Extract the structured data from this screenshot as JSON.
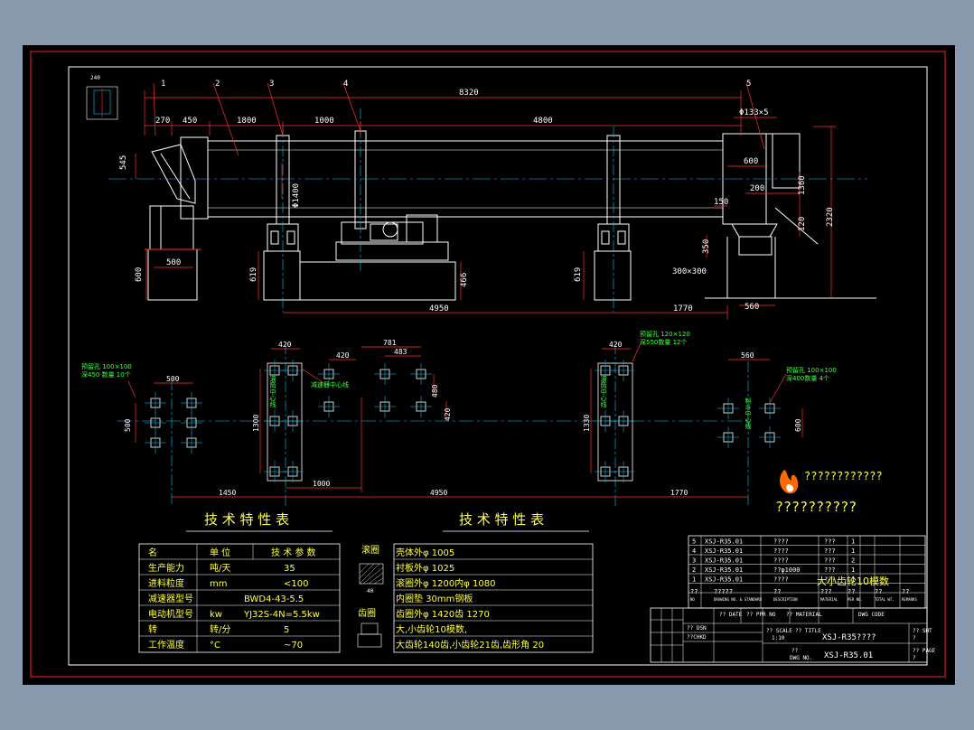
{
  "colors": {
    "background": "#000000",
    "border_red": "#ff2020",
    "geometry_white": "#ffffff",
    "dimension_red": "#ff3030",
    "centerline_cyan": "#00c8ff",
    "text_yellow": "#ffff40",
    "text_green": "#40ff40",
    "title_yellow": "#ffff00",
    "frame_white": "#ffffff",
    "page_gray": "#8a9aae"
  },
  "labels": {
    "item1": "1",
    "item2": "2",
    "item3": "3",
    "item4": "4",
    "item5": "5",
    "detail_small": "240"
  },
  "dims_top": {
    "total": "8320",
    "d270": "270",
    "d450": "450",
    "d1800": "1800",
    "d1000": "1000",
    "d4800": "4800",
    "d545": "545",
    "dia1400": "Φ1400",
    "d600l": "600",
    "d500": "500",
    "d619l": "619",
    "d466": "466",
    "d619r": "619",
    "d4950": "4950",
    "d1770": "1770",
    "dia133": "Φ133×5",
    "d600r": "600",
    "d200": "200",
    "d150": "150",
    "d1360": "1360",
    "d120": "120",
    "d2320": "2320",
    "d350": "350",
    "d300x300": "300×300",
    "d560": "560"
  },
  "dims_plan": {
    "d420a": "420",
    "d420b": "420",
    "d781": "781",
    "d483": "483",
    "d480": "480",
    "d420c": "420",
    "d500": "500",
    "d500v": "500",
    "d1300l": "1300",
    "d1330r": "1330",
    "d420r": "420",
    "d560": "560",
    "d600": "600",
    "d1000": "1000",
    "d1450": "1450",
    "d4950": "4950",
    "d1770": "1770",
    "hole_left_1": "预留孔 100×100",
    "hole_left_2": "深450 数量 10个",
    "hole_mid_1": "预留孔 120×120",
    "hole_mid_2": "深550数量 12个",
    "hole_right_1": "预留孔 100×100",
    "hole_right_2": "深400数量 4个",
    "axis_label": "减速器中心线",
    "vert_label_1": "滚筒中心线",
    "vert_label_2": "滚筒中心线",
    "vert_label_3": "料斗中心线"
  },
  "spec_table": {
    "heading": "技 术 特 性 表",
    "columns": [
      "名",
      "单 位",
      "技 术 参 数"
    ],
    "rows": [
      [
        "生产能力",
        "吨/天",
        "35"
      ],
      [
        "进料粒度",
        "mm",
        "<100"
      ],
      [
        "减速器型号",
        "",
        "BWD4-43-5.5"
      ],
      [
        "电动机型号",
        "kw",
        "YJ32S-4N=5.5kw"
      ],
      [
        "转",
        "转/分",
        "5"
      ],
      [
        "工作温度",
        "°C",
        "~70"
      ]
    ]
  },
  "gear_table": {
    "heading": "技 术 特 性 表",
    "side_label_1": "滚圈",
    "side_label_2": "齿圈",
    "detail_dim": "40",
    "rows": [
      "壳体外φ  1005",
      "衬板外φ  1025",
      "滚圈外φ  1200内φ   1080",
      "内圈垫 30mm钢板",
      "齿圈外φ  1420齿   1270",
      "大,小齿轮10模数,",
      "大齿轮140齿,小齿轮21齿,齿形角 20"
    ]
  },
  "logo": {
    "line1": "????????????",
    "line2": "??????????"
  },
  "bom": {
    "rows": [
      {
        "no": "5",
        "code": "XSJ-R35.01",
        "name": "????",
        "qty": "???",
        "mat": "1"
      },
      {
        "no": "4",
        "code": "XSJ-R35.01",
        "name": "????",
        "qty": "???",
        "mat": "1"
      },
      {
        "no": "3",
        "code": "XSJ-R35.01",
        "name": "????",
        "qty": "???",
        "mat": "2"
      },
      {
        "no": "2",
        "code": "XSJ-R35.01",
        "name": "??φ1000",
        "qty": "???",
        "mat": "1"
      },
      {
        "no": "1",
        "code": "XSJ-R35.01",
        "name": "????",
        "qty": "???",
        "mat": "1"
      }
    ],
    "overlay_note": "大小齿轮10模数",
    "header": [
      "??",
      "?????",
      "??",
      "???",
      "??",
      "??",
      "??"
    ],
    "header_sub": [
      "NO",
      "DRAWING NO. & STANDARD",
      "DESCRIPTION",
      "MATERIAL",
      "PER NO.",
      "TOTAL WT.",
      "REMARKS"
    ]
  },
  "title_block": {
    "left_codes": [
      "?? DSN",
      "??CHKD"
    ],
    "scale_label": "?? SCALE",
    "scale_value": "1:10",
    "date_label": "?? DATE",
    "ppr_label": "?? PPR NO",
    "title_label": "?? TITLE",
    "title_value": "XSJ-R35????",
    "material_label": "?? MATERIAL",
    "dwg_code": "DWG CODE",
    "sht_label": "?? SHT",
    "sht_value": "?",
    "dwg_no_label": "DWG NO.",
    "dwg_no_value": "XSJ-R35.01",
    "page_label": "?? PAGE",
    "page_value": "?",
    "num_label": "??"
  }
}
